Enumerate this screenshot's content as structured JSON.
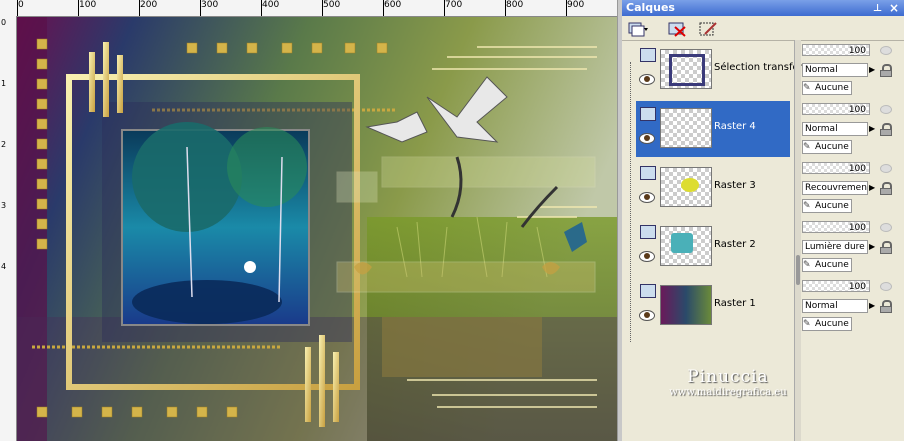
{
  "ruler": {
    "top_labels": [
      "0",
      "100",
      "200",
      "300",
      "400",
      "500",
      "600",
      "700",
      "800",
      "900"
    ],
    "left_labels": [
      "0",
      "1",
      "2",
      "3",
      "4"
    ]
  },
  "panel": {
    "title": "Calques",
    "layers": [
      {
        "name": "Sélection transform",
        "opacity": "100",
        "blend": "Normal",
        "mask": "Aucune",
        "selected": false
      },
      {
        "name": "Raster 4",
        "opacity": "100",
        "blend": "Normal",
        "mask": "Aucune",
        "selected": true
      },
      {
        "name": "Raster 3",
        "opacity": "100",
        "blend": "Recouvrement",
        "mask": "Aucune",
        "selected": false
      },
      {
        "name": "Raster 2",
        "opacity": "100",
        "blend": "Lumière dure",
        "mask": "Aucune",
        "selected": false
      },
      {
        "name": "Raster 1",
        "opacity": "100",
        "blend": "Normal",
        "mask": "Aucune",
        "selected": false
      }
    ]
  },
  "watermark": {
    "name": "Pinuccia",
    "url": "www.maidiregrafica.eu"
  },
  "colors": {
    "accent": "#316ac5",
    "title_bar": "#3d6bd0",
    "panel_bg": "#ece9d8"
  },
  "icons": {
    "new_layer": "new-layer-icon",
    "delete_layer": "delete-layer-icon",
    "edit_mask": "edit-mask-icon",
    "visibility": "eye-icon",
    "lock": "lock-icon"
  }
}
